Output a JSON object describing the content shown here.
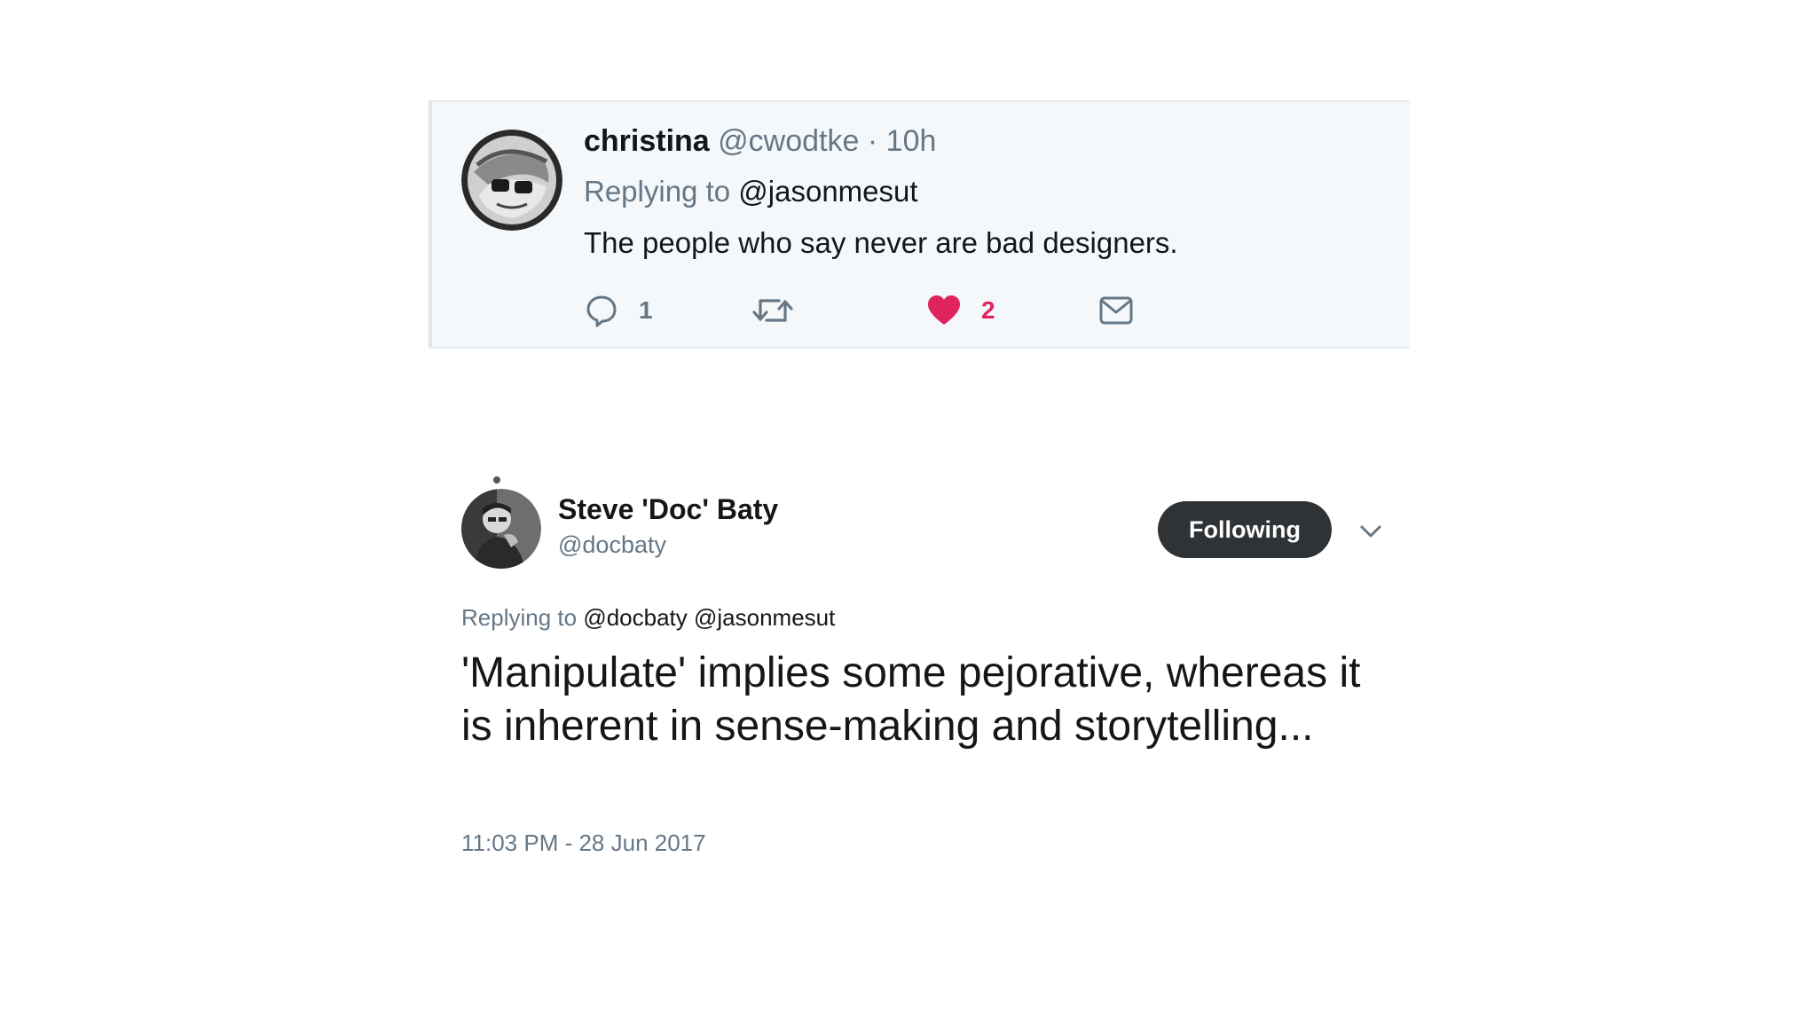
{
  "reply_tweet": {
    "author_name": "christina",
    "author_handle": "@cwodtke",
    "separator": "·",
    "time": "10h",
    "replying_label": "Replying to",
    "replying_to": "@jasonmesut",
    "text": "The people who say never are bad designers.",
    "actions": {
      "reply_icon": "reply-icon",
      "reply_count": "1",
      "retweet_icon": "retweet-icon",
      "like_icon": "heart-icon",
      "like_count": "2",
      "message_icon": "envelope-icon"
    },
    "colors": {
      "like": "#e0245e",
      "card_bg": "#f5f8fa"
    }
  },
  "main_tweet": {
    "author_name": "Steve 'Doc' Baty",
    "author_handle": "@docbaty",
    "follow_label": "Following",
    "menu_icon": "chevron-down-icon",
    "replying_label": "Replying to",
    "replying_to": "@docbaty @jasonmesut",
    "text": "'Manipulate' implies some pejorative, whereas it is inherent in sense-making and storytelling...",
    "timestamp": "11:03 PM - 28 Jun 2017",
    "colors": {
      "follow_button": "#2f3336"
    }
  }
}
